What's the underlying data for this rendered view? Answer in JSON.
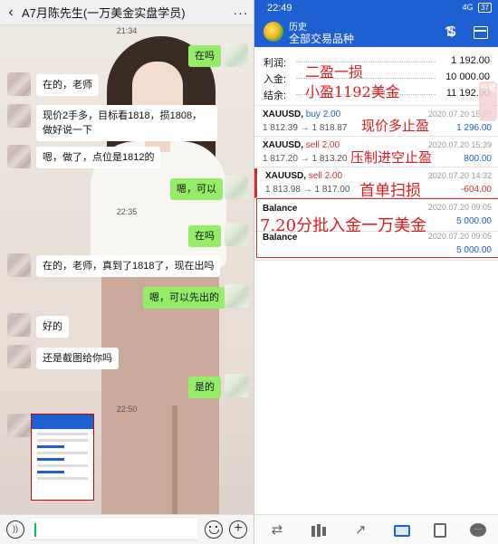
{
  "chat": {
    "title": "A7月陈先生(一万美金实盘学员)",
    "more_label": "···",
    "times": [
      "21:34",
      "22:35",
      "22:50"
    ],
    "messages": [
      {
        "side": "right",
        "text": "在吗"
      },
      {
        "side": "left",
        "text": "在的，老师"
      },
      {
        "side": "left",
        "text": "现价2手多，目标看1818，损1808，做好说一下"
      },
      {
        "side": "left",
        "text": "嗯，做了，点位是1812的"
      },
      {
        "side": "right",
        "text": "嗯，可以"
      },
      {
        "side": "right",
        "text": "在吗"
      },
      {
        "side": "left",
        "text": "在的，老师，真到了1818了，现在出吗"
      },
      {
        "side": "right",
        "text": "嗯，可以先出的"
      },
      {
        "side": "left",
        "text": "好的"
      },
      {
        "side": "left",
        "text": "还是截图给你吗"
      },
      {
        "side": "right",
        "text": "是的"
      }
    ],
    "input": {
      "value": ""
    }
  },
  "trade": {
    "status_time": "22:49",
    "status_right": "4G",
    "battery": "37",
    "subtitle": "历史",
    "title": "全部交易品种",
    "summary": [
      {
        "key": "利润:",
        "value": "1 192.00"
      },
      {
        "key": "入金:",
        "value": "10 000.00"
      },
      {
        "key": "结余:",
        "value": "11 192.00"
      }
    ],
    "trades": [
      {
        "symbol": "XAUUSD,",
        "direction": "buy 2.00",
        "side": "buy",
        "prices": "1 812.39 → 1 818.87",
        "datetime": "2020.07.20 15:37",
        "profit": "1 296.00",
        "profit_sign": "pos"
      },
      {
        "symbol": "XAUUSD,",
        "direction": "sell 2.00",
        "side": "sell",
        "prices": "1 817.20 → 1 813.20",
        "datetime": "2020.07.20 15:39",
        "profit": "800.00",
        "profit_sign": "pos"
      },
      {
        "symbol": "XAUUSD,",
        "direction": "sell 2.00",
        "side": "sell",
        "prices": "1 813.98 → 1 817.00",
        "datetime": "2020.07.20 14:32",
        "profit": "-604.00",
        "profit_sign": "neg"
      }
    ],
    "balances": [
      {
        "label": "Balance",
        "datetime": "2020.07.20 09:05",
        "amount": "5 000.00"
      },
      {
        "label": "Balance",
        "datetime": "2020.07.20 09:05",
        "amount": "5 000.00"
      }
    ],
    "annotations": {
      "a1": "二盈一损",
      "a2": "小盈1192美金",
      "a3": "现价多止盈",
      "a4": "压制进空止盈",
      "a5": "首单扫损",
      "a6": "7.20分批入金一万美金"
    },
    "watermark": "白鹭",
    "accent_color": "#1e5fd1",
    "loss_color": "#d0302b"
  }
}
